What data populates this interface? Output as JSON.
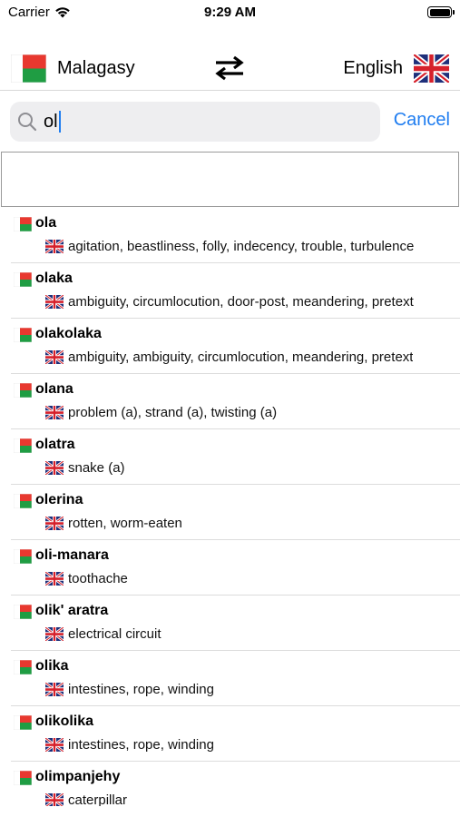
{
  "status_bar": {
    "carrier": "Carrier",
    "time": "9:29 AM"
  },
  "header": {
    "source_language": "Malagasy",
    "target_language": "English",
    "swap_icon": "swap-arrows-icon"
  },
  "search": {
    "value": "ol",
    "cancel_label": "Cancel",
    "icon": "magnifier-icon"
  },
  "colors": {
    "accent": "#1f7df0",
    "madagascar_red": "#e8382f",
    "madagascar_green": "#1f9d43",
    "uk_blue": "#1e2f7a",
    "uk_red": "#d6202b"
  },
  "results": [
    {
      "word": "ola",
      "translation": "agitation, beastliness, folly, indecency, trouble, turbulence"
    },
    {
      "word": "olaka",
      "translation": "ambiguity, circumlocution, door-post, meandering, pretext"
    },
    {
      "word": "olakolaka",
      "translation": "ambiguity, ambiguity, circumlocution, meandering, pretext"
    },
    {
      "word": "olana",
      "translation": "problem (a), strand (a), twisting (a)"
    },
    {
      "word": "olatra",
      "translation": "snake (a)"
    },
    {
      "word": "olerina",
      "translation": "rotten, worm-eaten"
    },
    {
      "word": "oli-manara",
      "translation": "toothache"
    },
    {
      "word": "olik' aratra",
      "translation": "electrical circuit"
    },
    {
      "word": "olika",
      "translation": "intestines, rope, winding"
    },
    {
      "word": "olikolika",
      "translation": "intestines, rope, winding"
    },
    {
      "word": "olimpanjehy",
      "translation": "caterpillar"
    }
  ]
}
